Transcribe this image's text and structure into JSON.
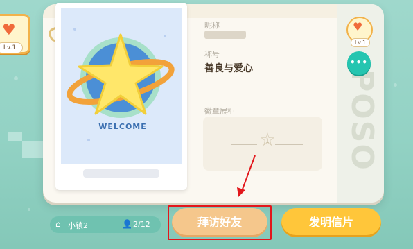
{
  "avatar": {
    "level": "Lv.1"
  },
  "profile": {
    "nickname_label": "昵称",
    "title_label": "称号",
    "title_value": "善良与爱心",
    "badge_cabinet_label": "徽章展柜",
    "badge_count": "1"
  },
  "side": {
    "level": "Lv.1",
    "more_label": "•••"
  },
  "photo": {
    "welcome_text": "WELCOME"
  },
  "bottom": {
    "town_label": "小镇2",
    "population": "2/12",
    "visit_button": "拜访好友",
    "postcard_button": "发明信片"
  },
  "colors": {
    "accent_teal": "#25c5b0",
    "visit_button": "#f5c78c",
    "postcard_button": "#ffc63a",
    "highlight": "#e2171c"
  }
}
